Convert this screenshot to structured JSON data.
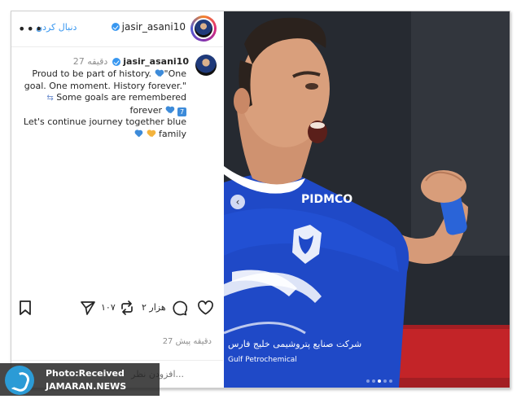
{
  "header": {
    "username": "jasir_asani10",
    "follow_label": "دنبال کردن",
    "more_label": "•••"
  },
  "caption": {
    "username": "jasir_asani10",
    "time": "27 دقیقه",
    "lines": [
      "Proud to be part of history.",
      "\"One goal. One moment. History forever.\"",
      "Some goals are remembered forever",
      "Let's continue journey together blue",
      "family"
    ]
  },
  "actions": {
    "like_icon": "heart-icon",
    "comment_icon": "comment-icon",
    "comment_count": "۲ هزار",
    "repost_icon": "repost-icon",
    "repost_count": "۱۰۷",
    "share_icon": "share-icon",
    "save_icon": "bookmark-icon"
  },
  "time_ago": "27 دقیقه پیش",
  "comment": {
    "placeholder": "افزودن نظر..."
  },
  "photo": {
    "jersey_sponsor": "PIDMCO",
    "jersey_text_fa": "شرکت صنایع پتروشیمی خلیج فارس",
    "jersey_text_en": "Gulf Petrochemical",
    "carousel_total": 5,
    "carousel_active": 3
  },
  "watermark": {
    "line1": "Photo:Received",
    "line2": "JAMARAN.NEWS"
  },
  "colors": {
    "verified": "#3897f0",
    "jersey_blue": "#1f49c7",
    "heart_blue": "#3d8bd9",
    "heart_yellow": "#f3b33d",
    "watermark_logo": "#2b9bd6"
  }
}
